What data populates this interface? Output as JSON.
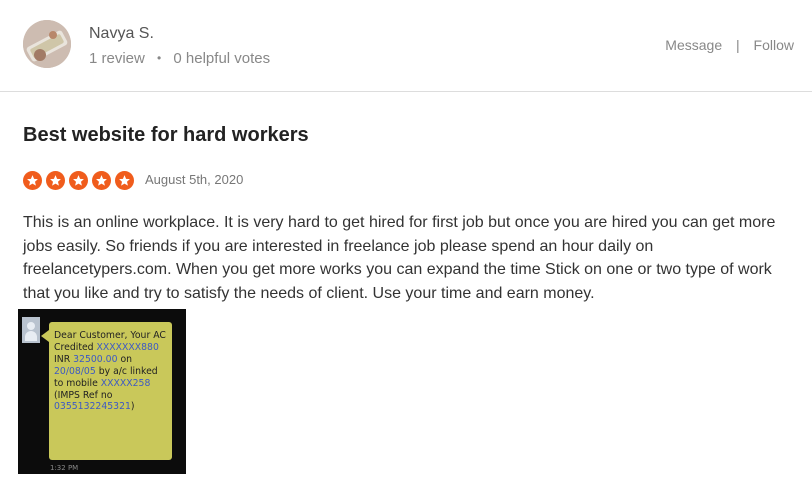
{
  "reviewer": {
    "name": "Navya S.",
    "review_count": "1 review",
    "helpful_votes": "0 helpful votes",
    "avatar_icon": "profile-photo"
  },
  "actions": {
    "message_label": "Message",
    "separator": "|",
    "follow_label": "Follow"
  },
  "review": {
    "title": "Best website for hard workers",
    "rating": 5,
    "rating_max": 5,
    "star_color": "#f05c1c",
    "date": "August 5th, 2020",
    "body": "This is an online workplace. It is very hard to get hired for first job but once you are hired you can get more jobs easily. So friends if you are interested in freelance job please spend an hour daily on freelancetypers.com. When you get more works you can expand the time Stick on one or two type of work that you like and try to satisfy the needs of client. Use your time and earn money."
  },
  "attachment": {
    "line1": "Dear Customer, Your AC",
    "line2_prefix": "Credited ",
    "line2_value": "XXXXXXX880",
    "line3_prefix": "INR ",
    "line3_value": "32500.00",
    "line3_suffix": " on",
    "line4_value": "20/08/05",
    "line4_suffix": " by a/c linked",
    "line5_prefix": "to mobile ",
    "line5_value": "XXXXX258",
    "line6": "(IMPS Ref no",
    "line7_value": "0355132245321",
    "line7_suffix": ")",
    "time": "1:32 PM",
    "bubble_color": "#c9c85a"
  }
}
